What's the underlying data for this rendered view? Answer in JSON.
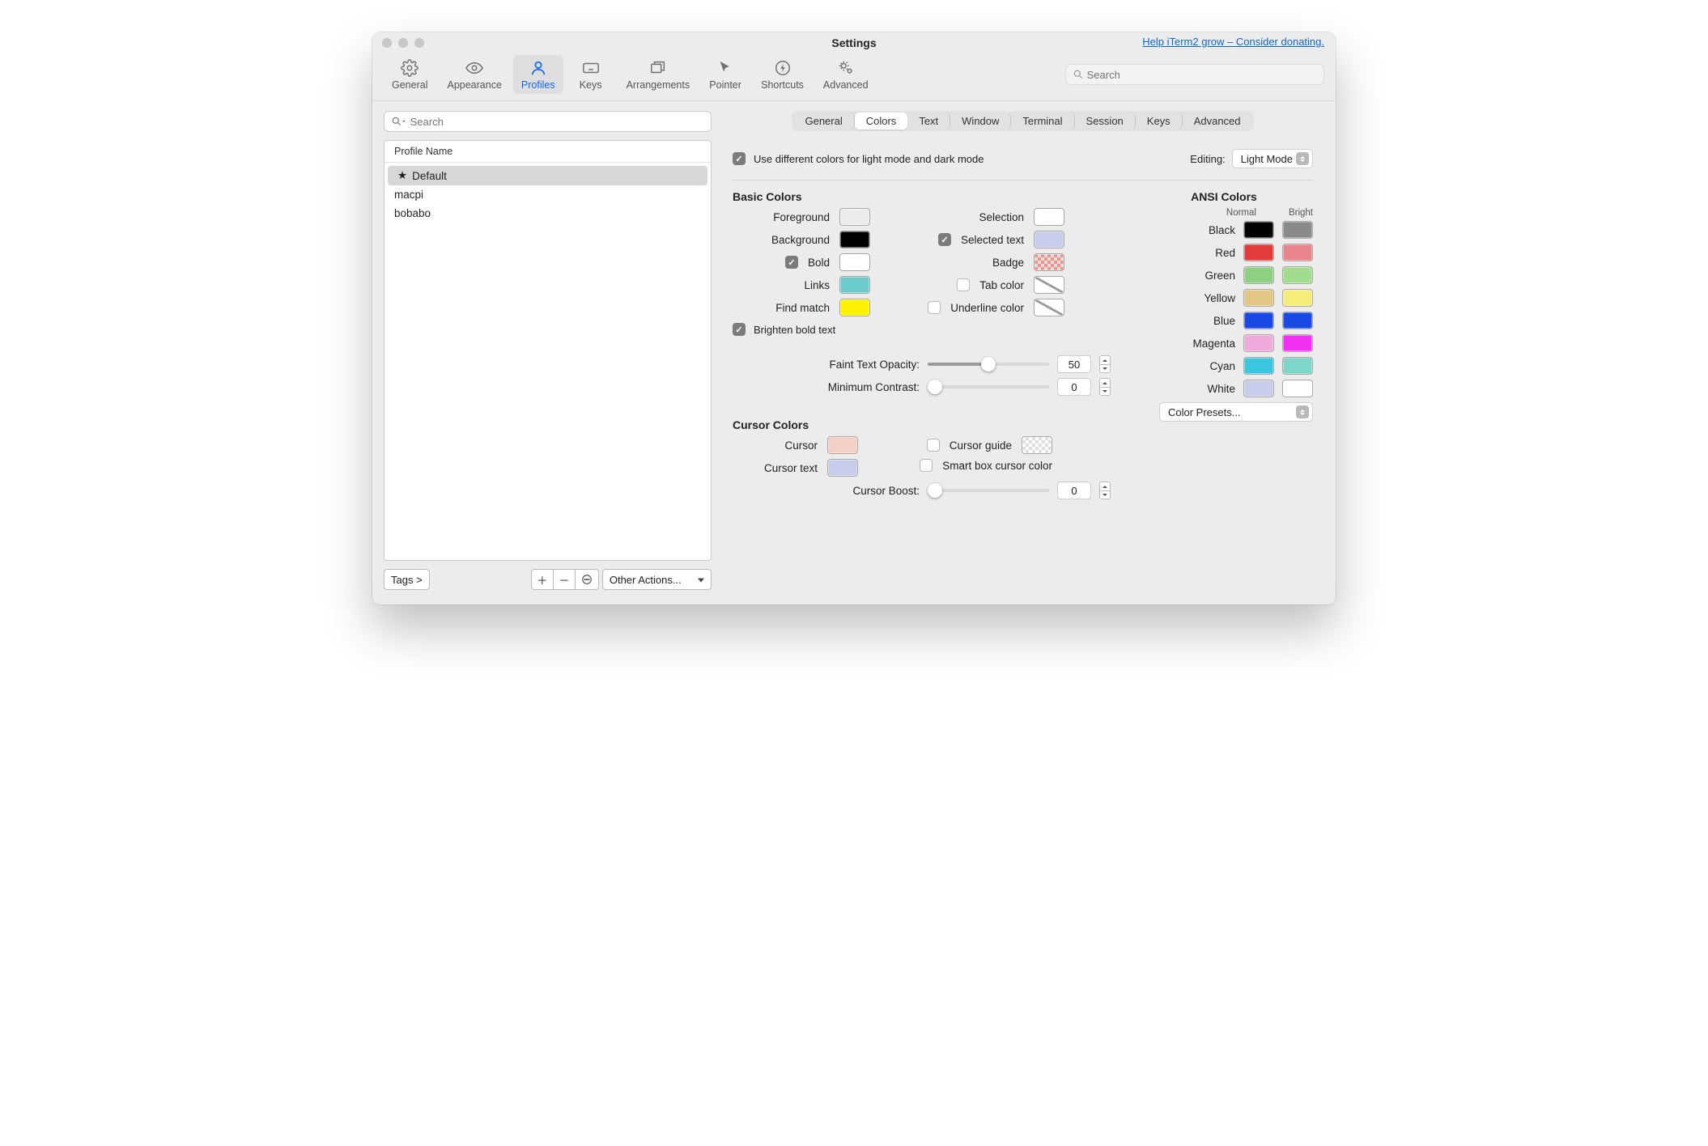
{
  "title": "Settings",
  "donate_link": "Help iTerm2 grow – Consider donating.",
  "toolbar": {
    "items": [
      {
        "label": "General"
      },
      {
        "label": "Appearance"
      },
      {
        "label": "Profiles"
      },
      {
        "label": "Keys"
      },
      {
        "label": "Arrangements"
      },
      {
        "label": "Pointer"
      },
      {
        "label": "Shortcuts"
      },
      {
        "label": "Advanced"
      }
    ],
    "search_placeholder": "Search"
  },
  "sidebar": {
    "search_placeholder": "Search",
    "header": "Profile Name",
    "profiles": [
      {
        "label": "Default",
        "starred": true,
        "selected": true
      },
      {
        "label": "macpi"
      },
      {
        "label": "bobabo"
      }
    ],
    "tags_label": "Tags >",
    "other_actions_label": "Other Actions..."
  },
  "subtabs": [
    "General",
    "Colors",
    "Text",
    "Window",
    "Terminal",
    "Session",
    "Keys",
    "Advanced"
  ],
  "mode": {
    "use_diff_label": "Use different colors for light mode and dark mode",
    "editing_label": "Editing:",
    "editing_value": "Light Mode"
  },
  "basic": {
    "title": "Basic Colors",
    "rows1": [
      {
        "label": "Foreground",
        "color": "#ffffff"
      },
      {
        "label": "Background",
        "color": "#000000"
      },
      {
        "label": "Bold",
        "color": "#ffffff",
        "checkbox": true,
        "checked": true
      },
      {
        "label": "Links",
        "color": "#6ecbce"
      },
      {
        "label": "Find match",
        "color": "#fff200"
      }
    ],
    "brighten_label": "Brighten bold text",
    "rows2": [
      {
        "label": "Selection",
        "color": "#ffffff"
      },
      {
        "label": "Selected text",
        "color": "#c7cdea",
        "checkbox": true,
        "checked": true
      },
      {
        "label": "Badge",
        "color": "#f29187",
        "checker": true
      },
      {
        "label": "Tab color",
        "none": true,
        "checkbox": true,
        "checked": false
      },
      {
        "label": "Underline color",
        "none": true,
        "checkbox": true,
        "checked": false
      }
    ],
    "faint_label": "Faint Text Opacity:",
    "faint_value": "50",
    "contrast_label": "Minimum Contrast:",
    "contrast_value": "0"
  },
  "ansi": {
    "title": "ANSI Colors",
    "normal_label": "Normal",
    "bright_label": "Bright",
    "rows": [
      {
        "label": "Black",
        "n": "#000000",
        "b": "#8a8a8a"
      },
      {
        "label": "Red",
        "n": "#e33a3a",
        "b": "#e8848b"
      },
      {
        "label": "Green",
        "n": "#90d083",
        "b": "#a2dd8f"
      },
      {
        "label": "Yellow",
        "n": "#e3c885",
        "b": "#f6ed78"
      },
      {
        "label": "Blue",
        "n": "#1a49e6",
        "b": "#1a49e6"
      },
      {
        "label": "Magenta",
        "n": "#eeaadb",
        "b": "#f22ff2"
      },
      {
        "label": "Cyan",
        "n": "#3bc6e0",
        "b": "#7dd6c7"
      },
      {
        "label": "White",
        "n": "#c7cdea",
        "b": "#ffffff"
      }
    ],
    "preset_label": "Color Presets..."
  },
  "cursor": {
    "title": "Cursor Colors",
    "rows1": [
      {
        "label": "Cursor",
        "color": "#f3cfc4"
      },
      {
        "label": "Cursor text",
        "color": "#c7cdea"
      }
    ],
    "guide_label": "Cursor guide",
    "smart_label": "Smart box cursor color",
    "boost_label": "Cursor Boost:",
    "boost_value": "0"
  }
}
